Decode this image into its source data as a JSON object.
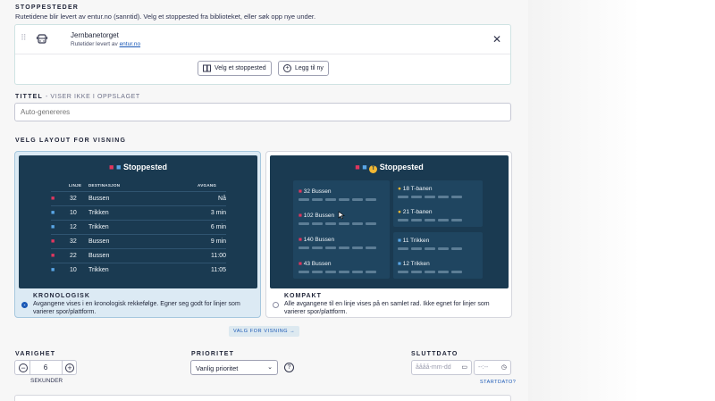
{
  "stops": {
    "title": "STOPPESTEDER",
    "description": "Rutetidene blir levert av entur.no (sanntid). Velg et stoppested fra biblioteket, eller søk opp nye under.",
    "items": [
      {
        "name": "Jernbanetorget",
        "sub_prefix": "Rutetider levert av",
        "sub_link": "entur.no"
      }
    ],
    "choose_button": "Velg et stoppested",
    "add_button": "Legg til ny"
  },
  "title_field": {
    "label": "TITTEL",
    "label_note": "- VISER IKKE I OPPSLAGET",
    "placeholder": "Auto-genereres"
  },
  "layout": {
    "title": "VELG LAYOUT FOR VISNING",
    "options": [
      {
        "board_title": "Stoppested",
        "columns": {
          "line": "LINJE",
          "destination": "DESTINASJON",
          "departure": "AVGANG"
        },
        "rows": [
          {
            "mode": "bus",
            "line": "32",
            "dest": "Bussen",
            "time": "Nå"
          },
          {
            "mode": "tram",
            "line": "10",
            "dest": "Trikken",
            "time": "3 min"
          },
          {
            "mode": "tram",
            "line": "12",
            "dest": "Trikken",
            "time": "6 min"
          },
          {
            "mode": "bus",
            "line": "32",
            "dest": "Bussen",
            "time": "9 min"
          },
          {
            "mode": "bus",
            "line": "22",
            "dest": "Bussen",
            "time": "11:00"
          },
          {
            "mode": "tram",
            "line": "10",
            "dest": "Trikken",
            "time": "11:05"
          }
        ],
        "label": "KRONOLOGISK",
        "description": "Avgangene vises i en kronologisk rekkefølge. Egner seg godt for linjer som varierer spor/plattform.",
        "selected": true
      },
      {
        "board_title": "Stoppested",
        "metro_badge": "T",
        "left": [
          "32 Bussen",
          "102 Bussen",
          "140 Bussen",
          "43 Bussen"
        ],
        "right_metro": [
          "18 T-banen",
          "21 T-banen"
        ],
        "right_tram": [
          "11 Trikken",
          "12 Trikken"
        ],
        "label": "KOMPAKT",
        "description": "Alle avgangene til en linje vises på en samlet rad. Ikke egnet for linjer som varierer spor/plattform.",
        "selected": false
      }
    ],
    "options_button": "VALG FOR VISNING →"
  },
  "duration": {
    "label": "VARIGHET",
    "value": "6",
    "unit": "SEKUNDER",
    "minus": "−",
    "plus": "+"
  },
  "priority": {
    "label": "PRIORITET",
    "selected": "Vanlig prioritet",
    "help": "?"
  },
  "end_date": {
    "label": "SLUTTDATO",
    "date_placeholder": "åååå-mm-dd",
    "time_placeholder": "--:--",
    "start_link": "STARTDATO?"
  },
  "colors": {
    "accent": "#1857b5",
    "bus": "#e0365e",
    "tram": "#5aa6e6",
    "metro": "#f2b833",
    "board": "#1a3a51"
  }
}
